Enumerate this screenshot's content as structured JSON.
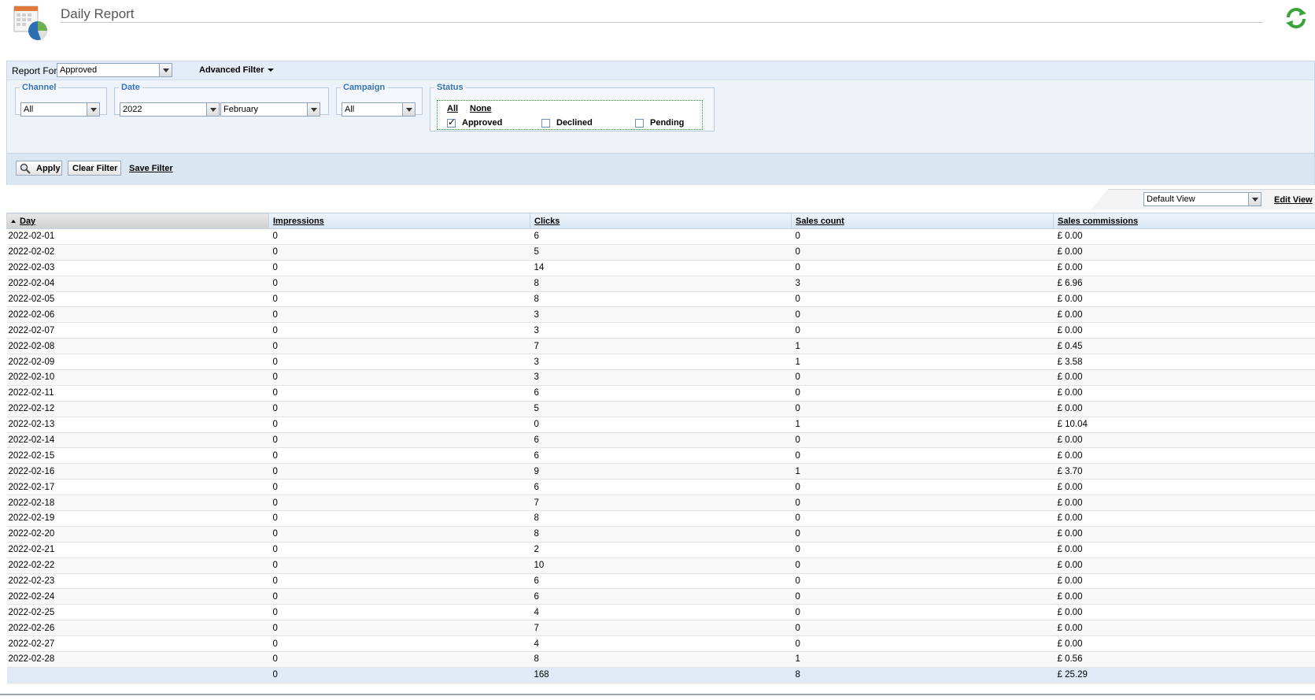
{
  "header": {
    "title": "Daily Report",
    "icons": {
      "report": "report-calendar-chart-icon",
      "refresh": "refresh-arrows-icon"
    }
  },
  "filter": {
    "report_for_label": "Report For",
    "report_for_value": "Approved",
    "advanced_filter_label": "Advanced Filter",
    "channel": {
      "legend": "Channel",
      "value": "All"
    },
    "date": {
      "legend": "Date",
      "year": "2022",
      "month": "February"
    },
    "campaign": {
      "legend": "Campaign",
      "value": "All"
    },
    "status": {
      "legend": "Status",
      "all_link": "All",
      "none_link": "None",
      "options": [
        {
          "label": "Approved",
          "checked": true
        },
        {
          "label": "Declined",
          "checked": false
        },
        {
          "label": "Pending",
          "checked": false
        }
      ]
    },
    "apply_label": "Apply",
    "clear_label": "Clear Filter",
    "save_label": "Save Filter"
  },
  "view": {
    "selected": "Default View",
    "edit_label": "Edit View"
  },
  "grid": {
    "columns": [
      "Day",
      "Impressions",
      "Clicks",
      "Sales count",
      "Sales commissions"
    ],
    "sorted_column": "Day",
    "rows": [
      [
        "2022-02-01",
        "0",
        "6",
        "0",
        "£ 0.00"
      ],
      [
        "2022-02-02",
        "0",
        "5",
        "0",
        "£ 0.00"
      ],
      [
        "2022-02-03",
        "0",
        "14",
        "0",
        "£ 0.00"
      ],
      [
        "2022-02-04",
        "0",
        "8",
        "3",
        "£ 6.96"
      ],
      [
        "2022-02-05",
        "0",
        "8",
        "0",
        "£ 0.00"
      ],
      [
        "2022-02-06",
        "0",
        "3",
        "0",
        "£ 0.00"
      ],
      [
        "2022-02-07",
        "0",
        "3",
        "0",
        "£ 0.00"
      ],
      [
        "2022-02-08",
        "0",
        "7",
        "1",
        "£ 0.45"
      ],
      [
        "2022-02-09",
        "0",
        "3",
        "1",
        "£ 3.58"
      ],
      [
        "2022-02-10",
        "0",
        "3",
        "0",
        "£ 0.00"
      ],
      [
        "2022-02-11",
        "0",
        "6",
        "0",
        "£ 0.00"
      ],
      [
        "2022-02-12",
        "0",
        "5",
        "0",
        "£ 0.00"
      ],
      [
        "2022-02-13",
        "0",
        "0",
        "1",
        "£ 10.04"
      ],
      [
        "2022-02-14",
        "0",
        "6",
        "0",
        "£ 0.00"
      ],
      [
        "2022-02-15",
        "0",
        "6",
        "0",
        "£ 0.00"
      ],
      [
        "2022-02-16",
        "0",
        "9",
        "1",
        "£ 3.70"
      ],
      [
        "2022-02-17",
        "0",
        "6",
        "0",
        "£ 0.00"
      ],
      [
        "2022-02-18",
        "0",
        "7",
        "0",
        "£ 0.00"
      ],
      [
        "2022-02-19",
        "0",
        "8",
        "0",
        "£ 0.00"
      ],
      [
        "2022-02-20",
        "0",
        "8",
        "0",
        "£ 0.00"
      ],
      [
        "2022-02-21",
        "0",
        "2",
        "0",
        "£ 0.00"
      ],
      [
        "2022-02-22",
        "0",
        "10",
        "0",
        "£ 0.00"
      ],
      [
        "2022-02-23",
        "0",
        "6",
        "0",
        "£ 0.00"
      ],
      [
        "2022-02-24",
        "0",
        "6",
        "0",
        "£ 0.00"
      ],
      [
        "2022-02-25",
        "0",
        "4",
        "0",
        "£ 0.00"
      ],
      [
        "2022-02-26",
        "0",
        "7",
        "0",
        "£ 0.00"
      ],
      [
        "2022-02-27",
        "0",
        "4",
        "0",
        "£ 0.00"
      ],
      [
        "2022-02-28",
        "0",
        "8",
        "1",
        "£ 0.56"
      ]
    ],
    "totals": [
      "",
      "0",
      "168",
      "8",
      "£ 25.29"
    ]
  }
}
